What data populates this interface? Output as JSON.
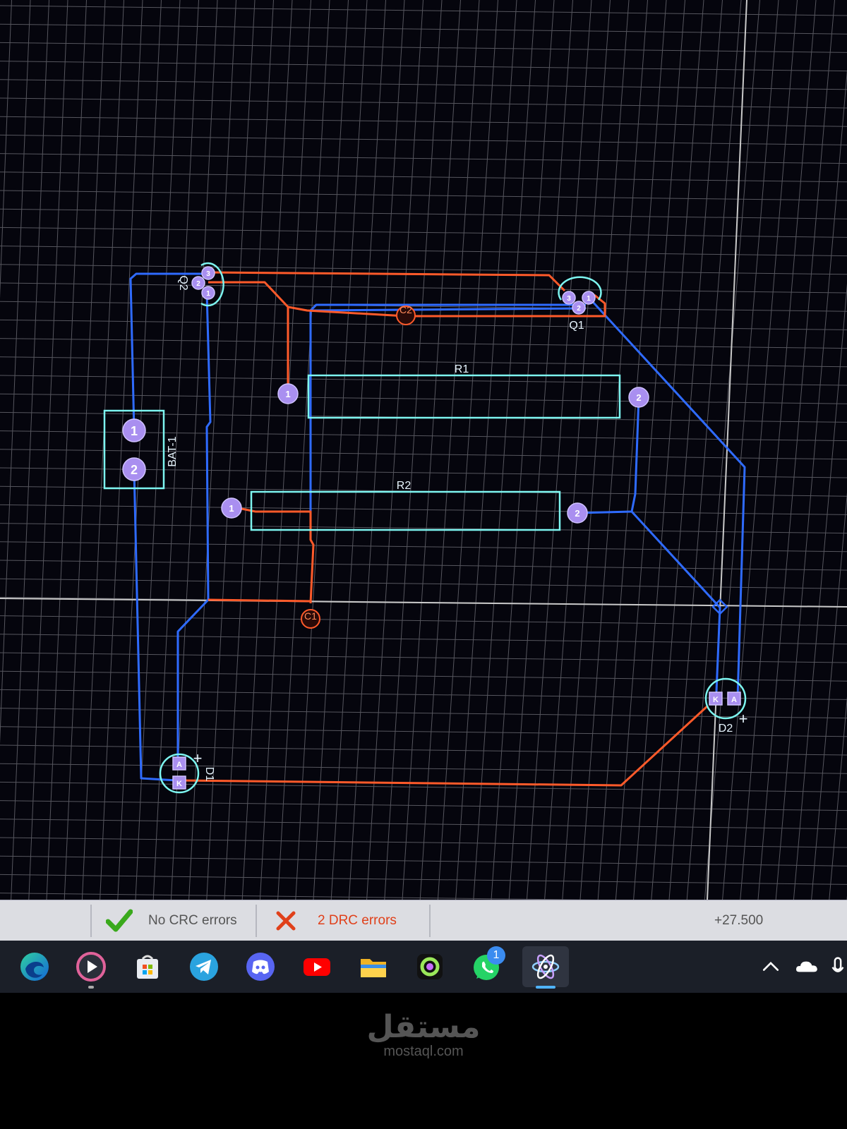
{
  "board": {
    "bg": "#05050d",
    "grid": "#56565e",
    "top_layer": "#ff5a2a",
    "bottom_layer": "#2f6bff",
    "silkscreen": "#7df5f0",
    "pad": "#a98ff0",
    "pad_text": "#ffffff"
  },
  "components": {
    "bat1": {
      "ref": "BAT-1",
      "pin1": "1",
      "pin2": "2"
    },
    "q1": {
      "ref": "Q1",
      "pins": [
        "3",
        "1",
        "2"
      ]
    },
    "q2": {
      "ref": "Q2",
      "pins": [
        "3",
        "2",
        "1"
      ]
    },
    "r1": {
      "ref": "R1",
      "pin1": "1",
      "pin2": "2"
    },
    "r2": {
      "ref": "R2",
      "pin1": "1",
      "pin2": "2"
    },
    "d1": {
      "ref": "D1",
      "pin_a": "A",
      "pin_k": "K",
      "polarity": "+"
    },
    "d2": {
      "ref": "D2",
      "pin_a": "A",
      "pin_k": "K",
      "polarity": "+"
    },
    "c1": {
      "ref": "C1"
    },
    "c2": {
      "ref": "C2"
    }
  },
  "status": {
    "crc_text": "No CRC errors",
    "drc_text": "2 DRC errors",
    "coord": "+27.500",
    "ok_color": "#3aa91c",
    "err_color": "#e0401a"
  },
  "taskbar": {
    "apps": [
      "edge-icon",
      "media-player-icon",
      "store-icon",
      "telegram-icon",
      "discord-icon",
      "youtube-icon",
      "file-explorer-icon",
      "arc-icon",
      "whatsapp-icon",
      "proteus-icon"
    ],
    "whatsapp_badge": "1"
  },
  "watermark": {
    "arabic": "مستقل",
    "latin": "mostaql.com"
  }
}
